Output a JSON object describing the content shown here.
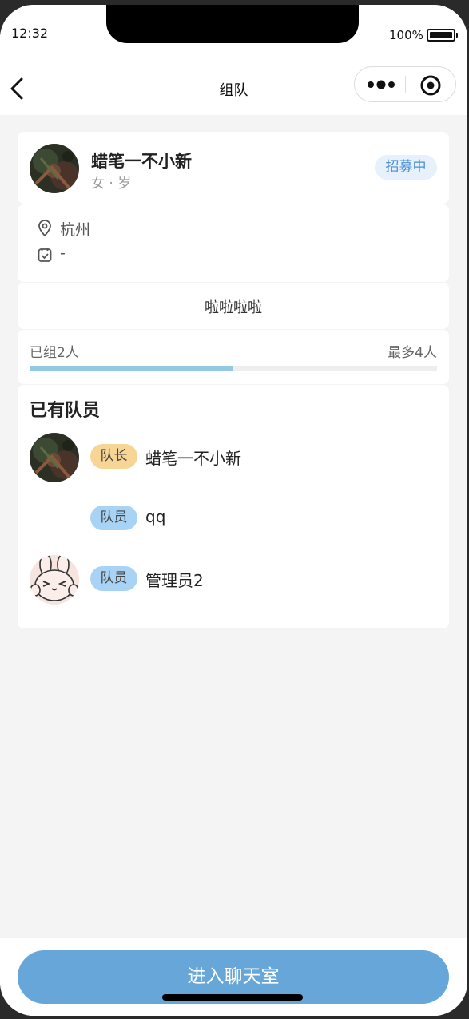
{
  "status_bar": {
    "time": "12:32",
    "battery": "100%",
    "battery_level": 1.0
  },
  "nav": {
    "title": "组队"
  },
  "leader": {
    "name": "蜡笔一不小新",
    "subtitle": "女 · 岁",
    "status": "招募中"
  },
  "info": {
    "location": "杭州",
    "date": "-"
  },
  "description": "啦啦啦啦",
  "progress": {
    "joined_text": "已组2人",
    "max_text": "最多4人",
    "joined": 2,
    "max": 4
  },
  "members_section": {
    "title": "已有队员",
    "members": [
      {
        "role": "队长",
        "name": "蜡笔一不小新",
        "avatar": "dark-photo-avatar"
      },
      {
        "role": "队员",
        "name": "qq",
        "avatar": "none"
      },
      {
        "role": "队员",
        "name": "管理员2",
        "avatar": "cartoon-rabbit-avatar"
      }
    ]
  },
  "bottom": {
    "button_label": "进入聊天室"
  },
  "colors": {
    "status_badge_bg": "#e7f1fb",
    "status_badge_text": "#4a90d6",
    "progress_fill": "#93c8e3",
    "leader_tag": "#f7d594",
    "member_tag": "#a8d3f5",
    "primary_button": "#66a6d8"
  }
}
